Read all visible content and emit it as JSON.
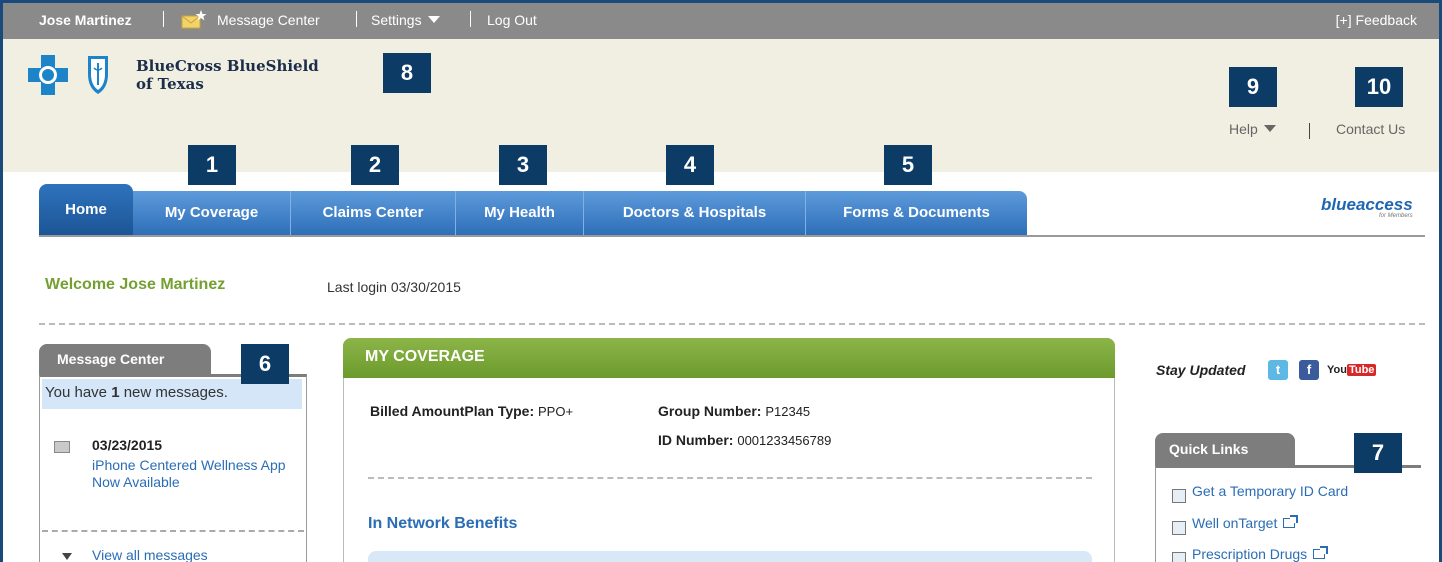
{
  "topbar": {
    "user": "Jose Martinez",
    "message_center": "Message Center",
    "settings": "Settings",
    "logout": "Log Out",
    "feedback": "[+]  Feedback"
  },
  "brand": {
    "line1": "BlueCross BlueShield",
    "line2": "of Texas"
  },
  "header": {
    "help": "Help",
    "contact": "Contact Us"
  },
  "callouts": [
    "1",
    "2",
    "3",
    "4",
    "5",
    "6",
    "7",
    "8",
    "9",
    "10"
  ],
  "nav": {
    "tabs": [
      "Home",
      "My Coverage",
      "Claims Center",
      "My Health",
      "Doctors & Hospitals",
      "Forms & Documents"
    ],
    "logo_text": "blueaccess",
    "logo_sub": "for Members"
  },
  "welcome": {
    "greeting": "Welcome Jose Martinez",
    "last_login": "Last login 03/30/2015"
  },
  "message_center": {
    "title": "Message Center",
    "notice_prefix": "You have ",
    "notice_count": "1",
    "notice_suffix": " new messages.",
    "message_date": "03/23/2015",
    "message_text": "iPhone Centered Wellness App Now Available",
    "view_all": "View all messages"
  },
  "coverage": {
    "title": "MY COVERAGE",
    "plan_label": "Billed AmountPlan Type:",
    "plan_value": "PPO+",
    "group_label": "Group Number:",
    "group_value": "P12345",
    "id_label": "ID Number:",
    "id_value": "0001233456789",
    "in_network": "In Network Benefits"
  },
  "right": {
    "stay_updated": "Stay Updated",
    "twitter": "t",
    "facebook": "f",
    "youtube_you": "You",
    "youtube_tube": "Tube",
    "quick_links_title": "Quick Links",
    "quick_links": [
      "Get a Temporary ID Card",
      "Well onTarget",
      "Prescription Drugs"
    ]
  },
  "colors": {
    "topbar": "#8a8a8a",
    "header": "#f1efe2",
    "nav_blue": "#2e6fb8",
    "callout": "#0c3b66",
    "welcome_green": "#74a032",
    "link": "#2a6db5"
  }
}
